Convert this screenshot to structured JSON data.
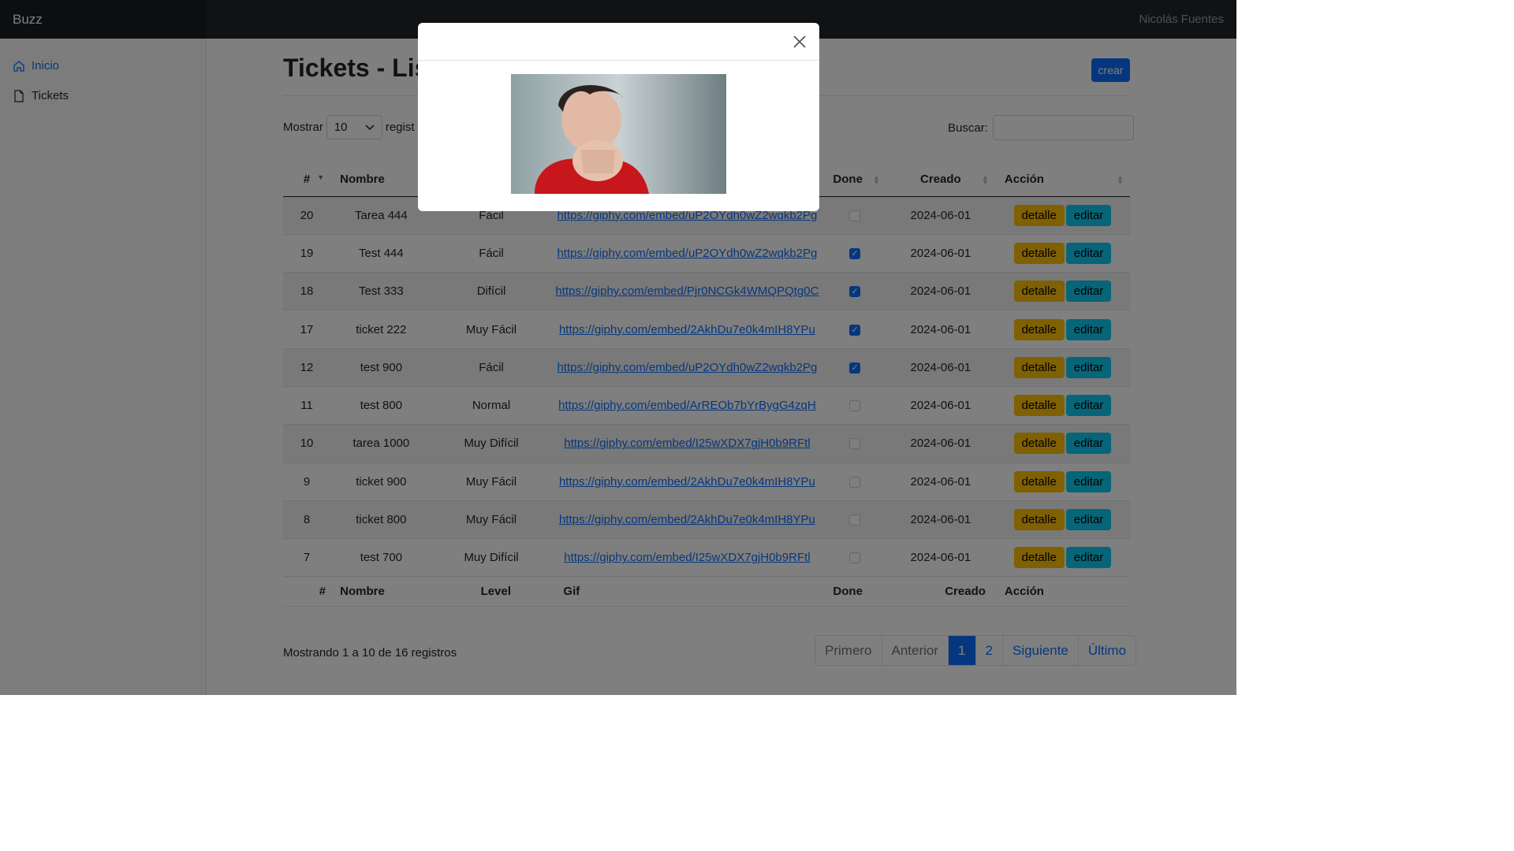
{
  "navbar": {
    "brand": "Buzz",
    "user": "Nicolás Fuentes"
  },
  "sidebar": {
    "items": [
      {
        "label": "Inicio",
        "icon": "home-icon",
        "active": true
      },
      {
        "label": "Tickets",
        "icon": "file-icon",
        "active": false
      }
    ]
  },
  "page": {
    "title": "Tickets - Lis",
    "create_label": "crear",
    "show_label": "Mostrar",
    "show_value": "10",
    "records_label": "regist",
    "search_label": "Buscar:",
    "search_value": ""
  },
  "table": {
    "headers": [
      "#",
      "Nombre",
      "Level",
      "Gif",
      "Done",
      "Creado",
      "Acción"
    ],
    "rows": [
      {
        "id": "20",
        "name": "Tarea 444",
        "level": "Fácil",
        "gif": "https://giphy.com/embed/uP2OYdh0wZ2wqkb2Pg",
        "done": false,
        "created": "2024-06-01"
      },
      {
        "id": "19",
        "name": "Test 444",
        "level": "Fácil",
        "gif": "https://giphy.com/embed/uP2OYdh0wZ2wqkb2Pg",
        "done": true,
        "created": "2024-06-01"
      },
      {
        "id": "18",
        "name": "Test 333",
        "level": "Difícil",
        "gif": "https://giphy.com/embed/Pjr0NCGk4WMQPQtg0C",
        "done": true,
        "created": "2024-06-01"
      },
      {
        "id": "17",
        "name": "ticket 222",
        "level": "Muy Fácil",
        "gif": "https://giphy.com/embed/2AkhDu7e0k4mIH8YPu",
        "done": true,
        "created": "2024-06-01"
      },
      {
        "id": "12",
        "name": "test 900",
        "level": "Fácil",
        "gif": "https://giphy.com/embed/uP2OYdh0wZ2wqkb2Pg",
        "done": true,
        "created": "2024-06-01"
      },
      {
        "id": "11",
        "name": "test 800",
        "level": "Normal",
        "gif": "https://giphy.com/embed/ArREOb7bYrBygG4zqH",
        "done": false,
        "created": "2024-06-01"
      },
      {
        "id": "10",
        "name": "tarea 1000",
        "level": "Muy Difícil",
        "gif": "https://giphy.com/embed/I25wXDX7gjH0b9RFtl",
        "done": false,
        "created": "2024-06-01"
      },
      {
        "id": "9",
        "name": "ticket 900",
        "level": "Muy Fácil",
        "gif": "https://giphy.com/embed/2AkhDu7e0k4mIH8YPu",
        "done": false,
        "created": "2024-06-01"
      },
      {
        "id": "8",
        "name": "ticket 800",
        "level": "Muy Fácil",
        "gif": "https://giphy.com/embed/2AkhDu7e0k4mIH8YPu",
        "done": false,
        "created": "2024-06-01"
      },
      {
        "id": "7",
        "name": "test 700",
        "level": "Muy Difícil",
        "gif": "https://giphy.com/embed/I25wXDX7gjH0b9RFtl",
        "done": false,
        "created": "2024-06-01"
      }
    ],
    "detail_label": "detalle",
    "edit_label": "editar"
  },
  "footer": {
    "info": "Mostrando 1 a 10 de 16 registros",
    "pagination": [
      {
        "label": "Primero",
        "state": "disabled"
      },
      {
        "label": "Anterior",
        "state": "disabled"
      },
      {
        "label": "1",
        "state": "active"
      },
      {
        "label": "2",
        "state": "normal"
      },
      {
        "label": "Siguiente",
        "state": "normal"
      },
      {
        "label": "Último",
        "state": "normal"
      }
    ]
  },
  "modal": {
    "image": "gif-preview-photo"
  },
  "colors": {
    "primary": "#0d6efd",
    "warning": "#ffc107",
    "info": "#0dcaf0",
    "navbar": "#212529"
  }
}
